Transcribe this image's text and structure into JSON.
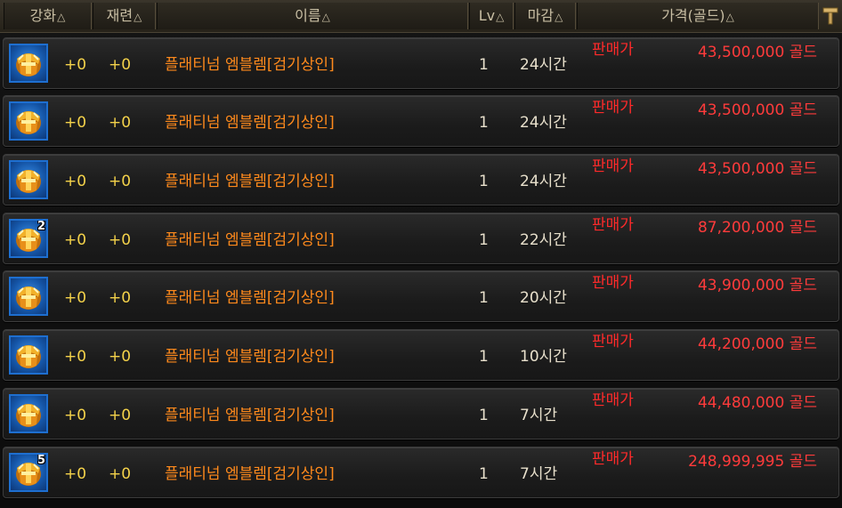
{
  "headers": {
    "enhance": "강화",
    "refine": "재련",
    "name": "이름",
    "level": "Lv",
    "deadline": "마감",
    "price": "가격(골드)",
    "sort_arrow": "△"
  },
  "colors": {
    "enhance_text": "#f4d24a",
    "item_name": "#ff8a1c",
    "price_text": "#ff3b3b",
    "seller_text": "#ff2a2a"
  },
  "pin_icon": "pin-icon",
  "listings": [
    {
      "enhance": "+0",
      "refine": "+0",
      "name": "플래티넘 엠블렘[검기상인]",
      "level": "1",
      "deadline": "24시간",
      "seller": "판매가",
      "price": "43,500,000 골드",
      "stack": ""
    },
    {
      "enhance": "+0",
      "refine": "+0",
      "name": "플래티넘 엠블렘[검기상인]",
      "level": "1",
      "deadline": "24시간",
      "seller": "판매가",
      "price": "43,500,000 골드",
      "stack": ""
    },
    {
      "enhance": "+0",
      "refine": "+0",
      "name": "플래티넘 엠블렘[검기상인]",
      "level": "1",
      "deadline": "24시간",
      "seller": "판매가",
      "price": "43,500,000 골드",
      "stack": ""
    },
    {
      "enhance": "+0",
      "refine": "+0",
      "name": "플래티넘 엠블렘[검기상인]",
      "level": "1",
      "deadline": "22시간",
      "seller": "판매가",
      "price": "87,200,000 골드",
      "stack": "2"
    },
    {
      "enhance": "+0",
      "refine": "+0",
      "name": "플래티넘 엠블렘[검기상인]",
      "level": "1",
      "deadline": "20시간",
      "seller": "판매가",
      "price": "43,900,000 골드",
      "stack": ""
    },
    {
      "enhance": "+0",
      "refine": "+0",
      "name": "플래티넘 엠블렘[검기상인]",
      "level": "1",
      "deadline": "10시간",
      "seller": "판매가",
      "price": "44,200,000 골드",
      "stack": ""
    },
    {
      "enhance": "+0",
      "refine": "+0",
      "name": "플래티넘 엠블렘[검기상인]",
      "level": "1",
      "deadline": "7시간",
      "seller": "판매가",
      "price": "44,480,000 골드",
      "stack": ""
    },
    {
      "enhance": "+0",
      "refine": "+0",
      "name": "플래티넘 엠블렘[검기상인]",
      "level": "1",
      "deadline": "7시간",
      "seller": "판매가",
      "price": "248,999,995 골드",
      "stack": "5"
    }
  ]
}
